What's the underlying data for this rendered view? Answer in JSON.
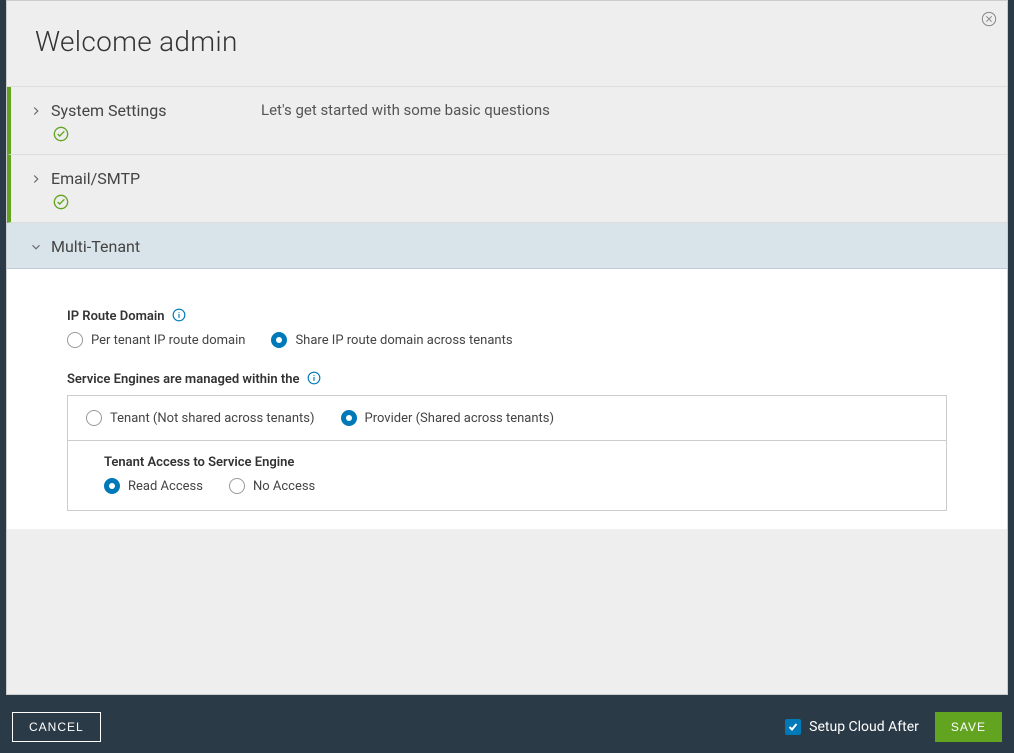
{
  "header": {
    "title": "Welcome admin"
  },
  "sections": {
    "system_settings": {
      "label": "System Settings",
      "description": "Let's get started with some basic questions"
    },
    "email_smtp": {
      "label": "Email/SMTP"
    },
    "multi_tenant": {
      "label": "Multi-Tenant"
    }
  },
  "ip_route": {
    "label": "IP Route Domain",
    "options": {
      "per_tenant": "Per tenant IP route domain",
      "shared": "Share IP route domain across tenants"
    },
    "selected": "shared"
  },
  "se_managed": {
    "label": "Service Engines are managed within the",
    "options": {
      "tenant": "Tenant (Not shared across tenants)",
      "provider": "Provider (Shared across tenants)"
    },
    "selected": "provider"
  },
  "tenant_access": {
    "label": "Tenant Access to Service Engine",
    "options": {
      "read": "Read Access",
      "none": "No Access"
    },
    "selected": "read"
  },
  "footer": {
    "cancel": "CANCEL",
    "setup_cloud": "Setup Cloud After",
    "setup_cloud_checked": true,
    "save": "SAVE"
  }
}
